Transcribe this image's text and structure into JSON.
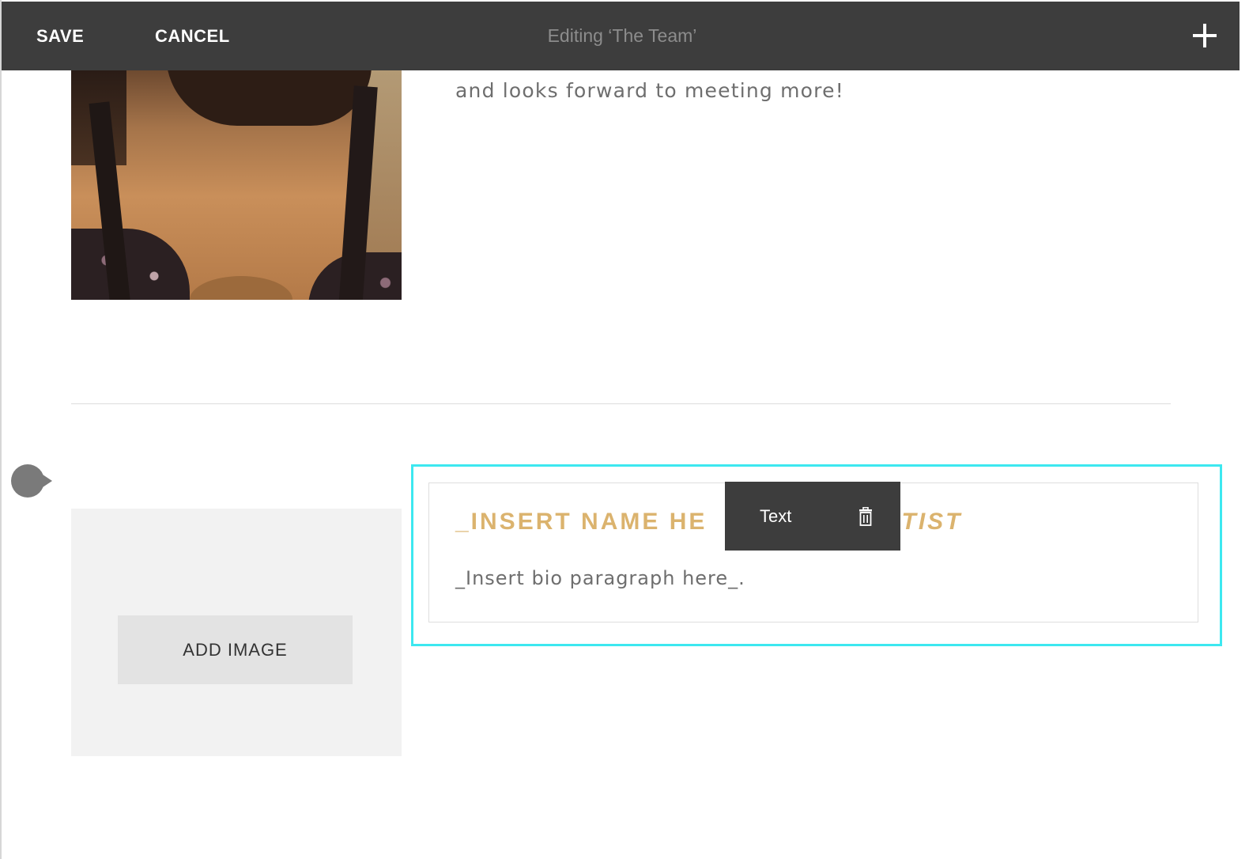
{
  "toolbar": {
    "save_label": "SAVE",
    "cancel_label": "CANCEL",
    "title": "Editing ‘The Team’",
    "add_icon": "plus-icon"
  },
  "team_member_1": {
    "bio_tail": "and looks forward to meeting more!"
  },
  "team_member_2": {
    "name_heading": "_INSERT NAME HE",
    "name_role_fragment": "RTIST",
    "bio": "_Insert bio paragraph here_.",
    "add_image_label": "ADD IMAGE"
  },
  "block_toolbar": {
    "type_label": "Text",
    "delete_icon": "trash-icon"
  },
  "colors": {
    "topbar_bg": "#3d3d3d",
    "heading_accent": "#dbb36e",
    "selection_outline": "#3de8f0",
    "body_text": "#6e6e6e"
  }
}
